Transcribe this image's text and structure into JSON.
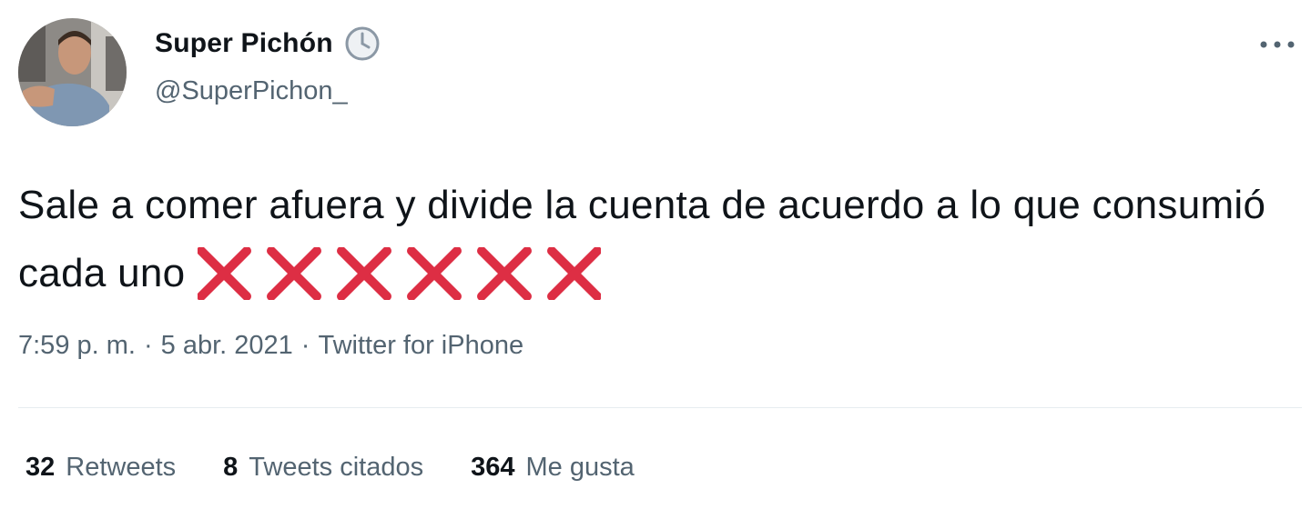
{
  "tweet": {
    "author": {
      "display_name": "Super Pichón",
      "handle": "@SuperPichon_",
      "badge_icon": "clock-icon"
    },
    "text": "Sale a comer afuera y divide la cuenta de acuerdo a lo que consumió cada uno",
    "emoji": {
      "name": "cross-mark-icon",
      "count": 6,
      "color": "#dd2e44"
    },
    "time": "7:59 p. m.",
    "date": "5 abr. 2021",
    "source": "Twitter for iPhone",
    "separator": "·",
    "stats": [
      {
        "count": "32",
        "label": "Retweets"
      },
      {
        "count": "8",
        "label": "Tweets citados"
      },
      {
        "count": "364",
        "label": "Me gusta"
      }
    ]
  },
  "colors": {
    "text": "#0f1419",
    "secondary": "#536471",
    "divider": "#e6ecf0",
    "cross": "#dd2e44"
  }
}
